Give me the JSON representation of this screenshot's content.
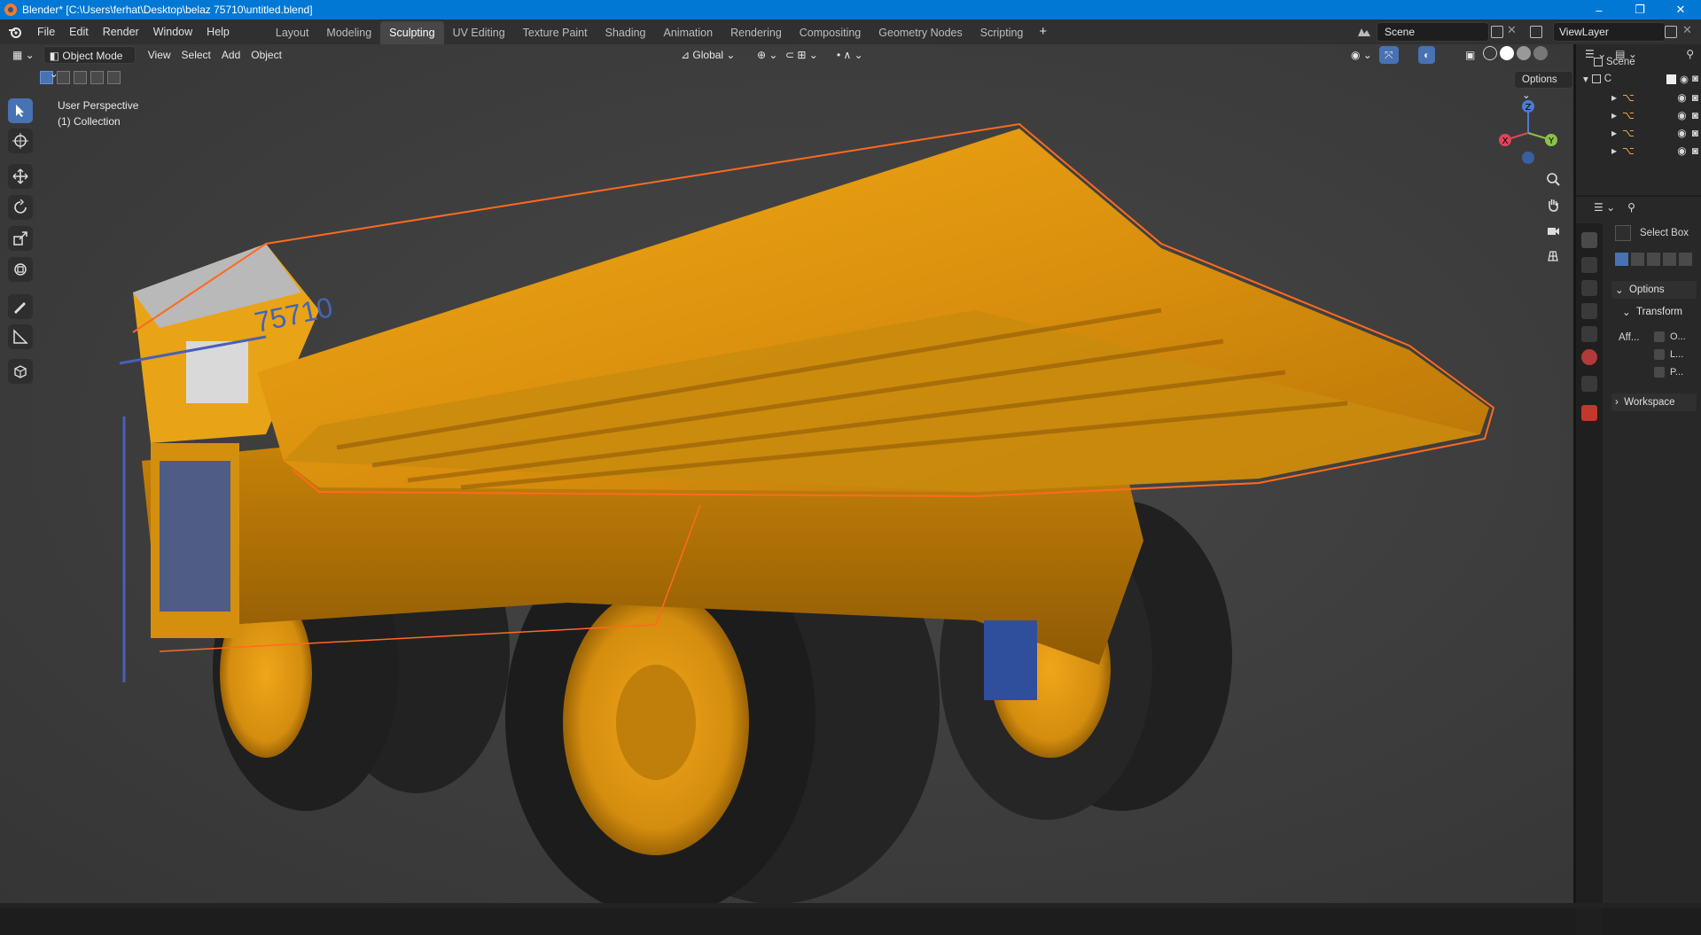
{
  "window": {
    "title": "Blender* [C:\\Users\\ferhat\\Desktop\\belaz 75710\\untitled.blend]",
    "controls": [
      "–",
      "❐",
      "✕"
    ]
  },
  "menus": [
    "File",
    "Edit",
    "Render",
    "Window",
    "Help"
  ],
  "workspaces": [
    {
      "label": "Layout",
      "active": false
    },
    {
      "label": "Modeling",
      "active": false
    },
    {
      "label": "Sculpting",
      "active": true
    },
    {
      "label": "UV Editing",
      "active": false
    },
    {
      "label": "Texture Paint",
      "active": false
    },
    {
      "label": "Shading",
      "active": false
    },
    {
      "label": "Animation",
      "active": false
    },
    {
      "label": "Rendering",
      "active": false
    },
    {
      "label": "Compositing",
      "active": false
    },
    {
      "label": "Geometry Nodes",
      "active": false
    },
    {
      "label": "Scripting",
      "active": false
    }
  ],
  "add_workspace": "+",
  "scene": {
    "label": "Scene"
  },
  "view_layer": {
    "label": "ViewLayer"
  },
  "viewport_header": {
    "mode": "Object Mode",
    "view": "View",
    "select": "Select",
    "add": "Add",
    "object": "Object",
    "orientation": "Global"
  },
  "viewport": {
    "info_line1": "User Perspective",
    "info_line2": "(1) Collection",
    "options": "Options",
    "gizmo": {
      "z": "Z",
      "y": "Y",
      "x": "X"
    },
    "model_label": "75710"
  },
  "outliner": {
    "root": "Scene",
    "collection": "C"
  },
  "properties": {
    "tool_name": "Select Box",
    "options_panel": "Options",
    "transform_panel": "Transform",
    "affect_label": "Aff...",
    "affect_items": [
      "O...",
      "L...",
      "P..."
    ],
    "workspace_panel": "Workspace"
  },
  "colors": {
    "accent": "#4772b3",
    "truck_yellow": "#e29a12",
    "selection_outline": "#ff6a1f",
    "titlebar": "#0078d4"
  }
}
